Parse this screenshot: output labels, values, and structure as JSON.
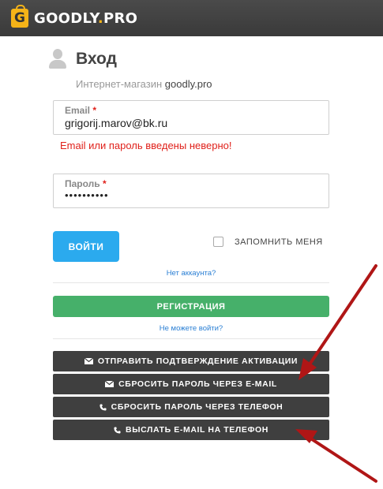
{
  "header": {
    "logo_letter": "G",
    "brand_main": "GOODLY",
    "brand_dot": ".",
    "brand_tld": "PRO"
  },
  "page": {
    "title": "Вход",
    "subtitle_prefix": "Интернет-магазин",
    "subtitle_site": "goodly.pro"
  },
  "form": {
    "email": {
      "label": "Email",
      "required_mark": "*",
      "value": "grigorij.marov@bk.ru"
    },
    "error": "Email или пароль введены неверно!",
    "password": {
      "label": "Пароль",
      "required_mark": "*",
      "value": "••••••••••"
    },
    "login_button": "ВОЙТИ",
    "remember_label": "ЗАПОМНИТЬ МЕНЯ",
    "remember_checked": false
  },
  "links": {
    "no_account": "Нет аккаунта?",
    "cant_login": "Не можете войти?"
  },
  "register_button": "РЕГИСТРАЦИЯ",
  "actions": [
    {
      "label": "ОТПРАВИТЬ ПОДТВЕРЖДЕНИЕ АКТИВАЦИИ",
      "icon": "envelope-icon"
    },
    {
      "label": "СБРОСИТЬ ПАРОЛЬ ЧЕРЕЗ E-MAIL",
      "icon": "envelope-icon"
    },
    {
      "label": "СБРОСИТЬ ПАРОЛЬ ЧЕРЕЗ ТЕЛЕФОН",
      "icon": "phone-icon"
    },
    {
      "label": "ВЫСЛАТЬ E-MAIL НА ТЕЛЕФОН",
      "icon": "phone-icon"
    }
  ],
  "colors": {
    "accent_blue": "#2baaee",
    "register_green": "#46b06a",
    "error_red": "#e0211b",
    "annotation_arrow": "#b01616",
    "logo_yellow": "#f5b318"
  }
}
